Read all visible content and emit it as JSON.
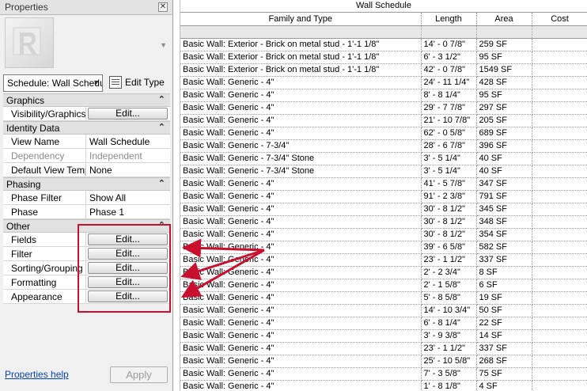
{
  "properties": {
    "title": "Properties",
    "close_glyph": "✕",
    "type_selector": "Schedule: Wall Schedule",
    "edit_type_label": "Edit Type",
    "groups": {
      "graphics": {
        "label": "Graphics",
        "rows": [
          {
            "name": "Visibility/Graphics Overrides",
            "button": "Edit..."
          }
        ]
      },
      "identity": {
        "label": "Identity Data",
        "rows": [
          {
            "name": "View Name",
            "value": "Wall Schedule"
          },
          {
            "name": "Dependency",
            "value": "Independent"
          },
          {
            "name": "Default View Template",
            "value": "None"
          }
        ]
      },
      "phasing": {
        "label": "Phasing",
        "rows": [
          {
            "name": "Phase Filter",
            "value": "Show All"
          },
          {
            "name": "Phase",
            "value": "Phase 1"
          }
        ]
      },
      "other": {
        "label": "Other",
        "rows": [
          {
            "name": "Fields",
            "button": "Edit..."
          },
          {
            "name": "Filter",
            "button": "Edit..."
          },
          {
            "name": "Sorting/Grouping",
            "button": "Edit..."
          },
          {
            "name": "Formatting",
            "button": "Edit..."
          },
          {
            "name": "Appearance",
            "button": "Edit..."
          }
        ]
      }
    },
    "help_link": "Properties help",
    "apply_label": "Apply"
  },
  "schedule": {
    "title": "Wall Schedule",
    "columns": [
      "Family and Type",
      "Length",
      "Area",
      "Cost"
    ],
    "rows": [
      [
        "Basic Wall: Exterior - Brick on metal stud - 1'-1 1/8\"",
        "14' - 0 7/8\"",
        "259 SF",
        ""
      ],
      [
        "Basic Wall: Exterior - Brick on metal stud - 1'-1 1/8\"",
        "6' - 3 1/2\"",
        "95 SF",
        ""
      ],
      [
        "Basic Wall: Exterior - Brick on metal stud - 1'-1 1/8\"",
        "42' - 0 7/8\"",
        "1549 SF",
        ""
      ],
      [
        "Basic Wall: Generic - 4\"",
        "24' - 11 1/4\"",
        "428 SF",
        ""
      ],
      [
        "Basic Wall: Generic - 4\"",
        "8' - 8 1/4\"",
        "95 SF",
        ""
      ],
      [
        "Basic Wall: Generic - 4\"",
        "29' - 7 7/8\"",
        "297 SF",
        ""
      ],
      [
        "Basic Wall: Generic - 4\"",
        "21' - 10 7/8\"",
        "205 SF",
        ""
      ],
      [
        "Basic Wall: Generic - 4\"",
        "62' - 0 5/8\"",
        "689 SF",
        ""
      ],
      [
        "Basic Wall: Generic - 7-3/4\"",
        "28' - 6 7/8\"",
        "396 SF",
        ""
      ],
      [
        "Basic Wall: Generic - 7-3/4\" Stone",
        "3' - 5 1/4\"",
        "40 SF",
        ""
      ],
      [
        "Basic Wall: Generic - 7-3/4\" Stone",
        "3' - 5 1/4\"",
        "40 SF",
        ""
      ],
      [
        "Basic Wall: Generic - 4\"",
        "41' - 5 7/8\"",
        "347 SF",
        ""
      ],
      [
        "Basic Wall: Generic - 4\"",
        "91' - 2 3/8\"",
        "791 SF",
        ""
      ],
      [
        "Basic Wall: Generic - 4\"",
        "30' - 8 1/2\"",
        "345 SF",
        ""
      ],
      [
        "Basic Wall: Generic - 4\"",
        "30' - 8 1/2\"",
        "348 SF",
        ""
      ],
      [
        "Basic Wall: Generic - 4\"",
        "30' - 8 1/2\"",
        "354 SF",
        ""
      ],
      [
        "Basic Wall: Generic - 4\"",
        "39' - 6 5/8\"",
        "582 SF",
        ""
      ],
      [
        "Basic Wall: Generic - 4\"",
        "23' - 1 1/2\"",
        "337 SF",
        ""
      ],
      [
        "Basic Wall: Generic - 4\"",
        "2' - 2 3/4\"",
        "8 SF",
        ""
      ],
      [
        "Basic Wall: Generic - 4\"",
        "2' - 1 5/8\"",
        "6 SF",
        ""
      ],
      [
        "Basic Wall: Generic - 4\"",
        "5' - 8 5/8\"",
        "19 SF",
        ""
      ],
      [
        "Basic Wall: Generic - 4\"",
        "14' - 10 3/4\"",
        "50 SF",
        ""
      ],
      [
        "Basic Wall: Generic - 4\"",
        "6' - 8 1/4\"",
        "22 SF",
        ""
      ],
      [
        "Basic Wall: Generic - 4\"",
        "3' - 9 3/8\"",
        "14 SF",
        ""
      ],
      [
        "Basic Wall: Generic - 4\"",
        "23' - 1 1/2\"",
        "337 SF",
        ""
      ],
      [
        "Basic Wall: Generic - 4\"",
        "25' - 10 5/8\"",
        "268 SF",
        ""
      ],
      [
        "Basic Wall: Generic - 4\"",
        "7' - 3 5/8\"",
        "75 SF",
        ""
      ],
      [
        "Basic Wall: Generic - 4\"",
        "1' - 8 1/8\"",
        "4 SF",
        ""
      ]
    ]
  },
  "colors": {
    "callout_red": "#c8102e",
    "link_blue": "#0645ad"
  }
}
